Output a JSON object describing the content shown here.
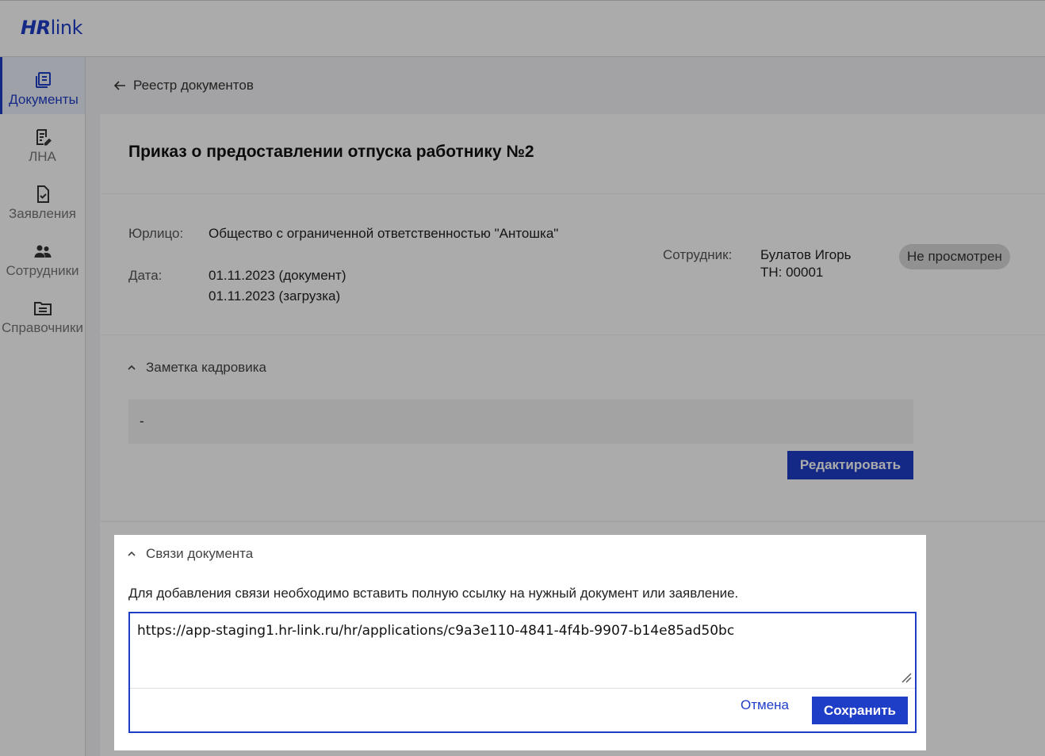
{
  "app": {
    "logo_hr": "HR",
    "logo_link": "link",
    "brand_color": "#1f3ec7"
  },
  "sidebar": {
    "items": [
      {
        "label": "Документы",
        "icon": "documents-icon",
        "active": true
      },
      {
        "label": "ЛНА",
        "icon": "lna-icon",
        "active": false
      },
      {
        "label": "Заявления",
        "icon": "applications-icon",
        "active": false
      },
      {
        "label": "Сотрудники",
        "icon": "employees-icon",
        "active": false
      },
      {
        "label": "Справочники",
        "icon": "directories-icon",
        "active": false
      }
    ]
  },
  "breadcrumb": {
    "back_label": "Реестр документов"
  },
  "document": {
    "title": "Приказ о предоставлении отпуска работнику №2",
    "entity_label": "Юрлицо:",
    "entity_value": "Общество с ограниченной ответственностью \"Антошка\"",
    "date_label": "Дата:",
    "date_document": "01.11.2023 (документ)",
    "date_upload": "01.11.2023 (загрузка)",
    "employee_label": "Сотрудник:",
    "employee_name": "Булатов Игорь",
    "employee_tn": "ТН: 00001",
    "status": "Не просмотрен"
  },
  "hr_note": {
    "title": "Заметка кадровика",
    "value": "-",
    "edit_label": "Редактировать"
  },
  "links": {
    "title": "Связи документа",
    "hint": "Для добавления связи необходимо вставить полную ссылку на нужный документ или заявление.",
    "input_value": "https://app-staging1.hr-link.ru/hr/applications/c9a3e110-4841-4f4b-9907-b14e85ad50bc",
    "cancel_label": "Отмена",
    "save_label": "Сохранить"
  }
}
